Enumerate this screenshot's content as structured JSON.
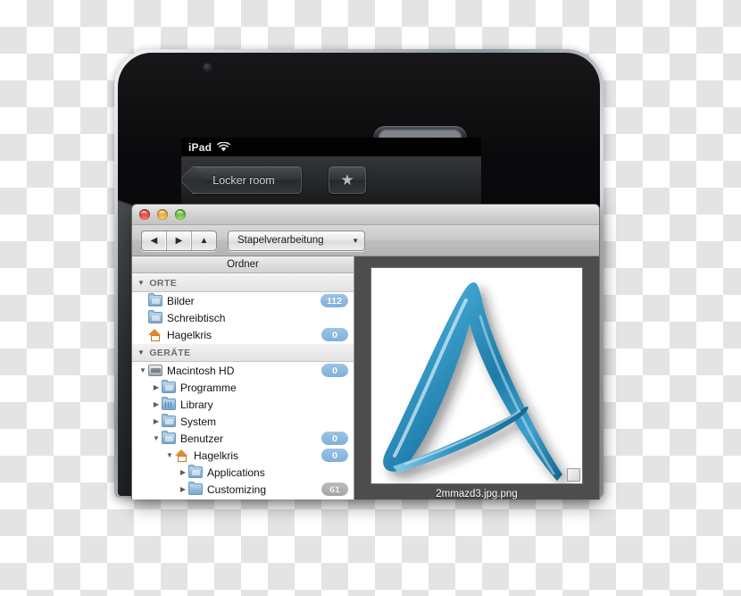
{
  "ipad": {
    "status_bar": {
      "device_label": "iPad",
      "wifi_icon": "wifi-icon"
    },
    "nav_bar": {
      "back_button_label": "Locker room",
      "star_button_icon": "star-icon",
      "star_glyph": "★"
    },
    "hardware": {
      "speaker_icon": "speaker-grille",
      "camera_icon": "front-camera"
    }
  },
  "finder": {
    "window_controls": {
      "close_label": "",
      "minimize_label": "",
      "zoom_label": ""
    },
    "toolbar": {
      "nav_back_glyph": "◀",
      "nav_forward_glyph": "▶",
      "nav_up_glyph": "▲",
      "popup_value": "Stapelverarbeitung",
      "popup_arrow_glyph": "▼"
    },
    "sidebar": {
      "column_header": "Ordner",
      "groups": [
        {
          "label": "ORTE",
          "triangle": "▼",
          "items": [
            {
              "label": "Bilder",
              "icon": "folder-pictures-icon",
              "indent": 1,
              "disclosure": "",
              "badge": "112",
              "badge_style": "blue"
            },
            {
              "label": "Schreibtisch",
              "icon": "folder-desktop-icon",
              "indent": 1,
              "disclosure": "",
              "badge": "",
              "badge_style": ""
            },
            {
              "label": "Hagelkris",
              "icon": "home-icon",
              "indent": 1,
              "disclosure": "",
              "badge": "0",
              "badge_style": "blue"
            }
          ]
        },
        {
          "label": "GERÄTE",
          "triangle": "▼",
          "items": [
            {
              "label": "Macintosh HD",
              "icon": "harddisk-icon",
              "indent": 1,
              "disclosure": "▼",
              "badge": "0",
              "badge_style": "blue"
            },
            {
              "label": "Programme",
              "icon": "folder-apps-icon",
              "indent": 2,
              "disclosure": "▶",
              "badge": "",
              "badge_style": ""
            },
            {
              "label": "Library",
              "icon": "folder-library-icon",
              "indent": 2,
              "disclosure": "▶",
              "badge": "",
              "badge_style": ""
            },
            {
              "label": "System",
              "icon": "folder-system-icon",
              "indent": 2,
              "disclosure": "▶",
              "badge": "",
              "badge_style": ""
            },
            {
              "label": "Benutzer",
              "icon": "folder-users-icon",
              "indent": 2,
              "disclosure": "▼",
              "badge": "0",
              "badge_style": "blue"
            },
            {
              "label": "Hagelkris",
              "icon": "home-icon",
              "indent": 3,
              "disclosure": "▼",
              "badge": "0",
              "badge_style": "blue"
            },
            {
              "label": "Applications",
              "icon": "folder-apps-icon",
              "indent": 4,
              "disclosure": "▶",
              "badge": "",
              "badge_style": ""
            },
            {
              "label": "Customizing",
              "icon": "folder-plain-icon",
              "indent": 4,
              "disclosure": "▶",
              "badge": "61",
              "badge_style": "gray"
            }
          ]
        }
      ]
    },
    "preview": {
      "filename": "2mmazd3.jpg.png",
      "image_alt": "blue-triangle-logo",
      "resize_handle_icon": "resize-grip-icon"
    }
  },
  "colors": {
    "badge_blue": "#7fb0db",
    "badge_gray": "#a5a5a5",
    "logo_blue": "#2b8bbe",
    "preview_background": "#4d4d4d",
    "checker_gray": "#e4e4e4"
  }
}
